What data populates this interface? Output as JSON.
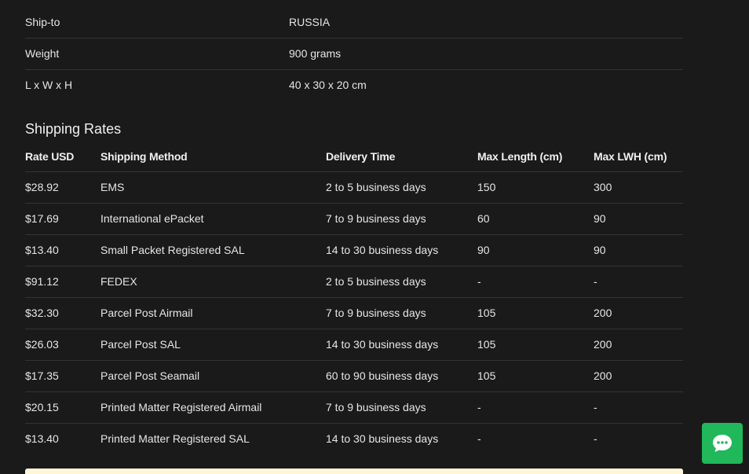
{
  "shipping_info": [
    {
      "label": "Ship-to",
      "value": "RUSSIA"
    },
    {
      "label": "Weight",
      "value": "900 grams"
    },
    {
      "label": "L x W x H",
      "value": "40 x 30 x 20 cm"
    }
  ],
  "rates": {
    "title": "Shipping Rates",
    "headers": {
      "rate": "Rate USD",
      "method": "Shipping Method",
      "delivery": "Delivery Time",
      "max_length": "Max Length (cm)",
      "max_lwh": "Max LWH (cm)"
    },
    "rows": [
      {
        "rate": "$28.92",
        "method": "EMS",
        "delivery": "2 to 5 business days",
        "max_length": "150",
        "max_lwh": "300"
      },
      {
        "rate": "$17.69",
        "method": "International ePacket",
        "delivery": "7 to 9 business days",
        "max_length": "60",
        "max_lwh": "90"
      },
      {
        "rate": "$13.40",
        "method": "Small Packet Registered SAL",
        "delivery": "14 to 30 business days",
        "max_length": "90",
        "max_lwh": "90"
      },
      {
        "rate": "$91.12",
        "method": "FEDEX",
        "delivery": "2 to 5 business days",
        "max_length": "-",
        "max_lwh": "-"
      },
      {
        "rate": "$32.30",
        "method": "Parcel Post Airmail",
        "delivery": "7 to 9 business days",
        "max_length": "105",
        "max_lwh": "200"
      },
      {
        "rate": "$26.03",
        "method": "Parcel Post SAL",
        "delivery": "14 to 30 business days",
        "max_length": "105",
        "max_lwh": "200"
      },
      {
        "rate": "$17.35",
        "method": "Parcel Post Seamail",
        "delivery": "60 to 90 business days",
        "max_length": "105",
        "max_lwh": "200"
      },
      {
        "rate": "$20.15",
        "method": "Printed Matter Registered Airmail",
        "delivery": "7 to 9 business days",
        "max_length": "-",
        "max_lwh": "-"
      },
      {
        "rate": "$13.40",
        "method": "Printed Matter Registered SAL",
        "delivery": "14 to 30 business days",
        "max_length": "-",
        "max_lwh": "-"
      }
    ]
  },
  "chat": {
    "icon": "chat-bubble-icon"
  },
  "colors": {
    "background": "#1a1a1a",
    "text": "#e6e6e6",
    "divider": "#333333",
    "chat_button": "#20b85a",
    "notice_bar": "#fdf6d8"
  }
}
